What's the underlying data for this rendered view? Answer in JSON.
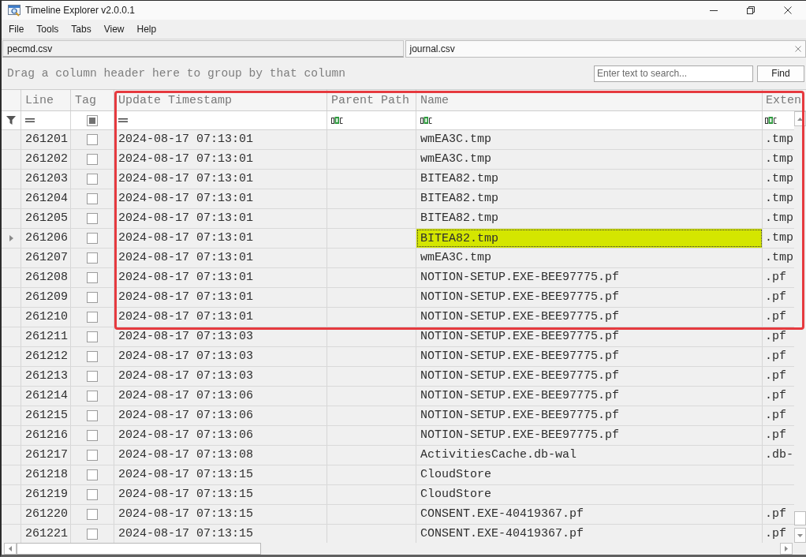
{
  "window": {
    "title": "Timeline Explorer v2.0.0.1"
  },
  "menu": [
    "File",
    "Tools",
    "Tabs",
    "View",
    "Help"
  ],
  "tabs": [
    {
      "label": "pecmd.csv",
      "selected": false
    },
    {
      "label": "journal.csv",
      "selected": true
    }
  ],
  "group_panel": {
    "hint": "Drag a column header here to group by that column"
  },
  "search": {
    "placeholder": "Enter text to search...",
    "button": "Find"
  },
  "table": {
    "columns": [
      {
        "label": "Line",
        "filter": {
          "kind": "equals"
        }
      },
      {
        "label": "Tag",
        "filter": {
          "kind": "tristate",
          "indeterminate": true
        }
      },
      {
        "label": "Update Timestamp",
        "filter": {
          "kind": "equals"
        }
      },
      {
        "label": "Parent Path",
        "filter": {
          "kind": "text"
        }
      },
      {
        "label": "Name",
        "filter": {
          "kind": "text"
        }
      },
      {
        "label": "Exten",
        "filter": {
          "kind": "text"
        }
      }
    ],
    "rows": [
      {
        "line": "261201",
        "tagged": false,
        "update_timestamp": "2024-08-17 07:13:01",
        "name": "wmEA3C.tmp",
        "extension": ".tmp",
        "selected": false,
        "name_focused": false
      },
      {
        "line": "261202",
        "tagged": false,
        "update_timestamp": "2024-08-17 07:13:01",
        "name": "wmEA3C.tmp",
        "extension": ".tmp",
        "selected": false,
        "name_focused": false
      },
      {
        "line": "261203",
        "tagged": false,
        "update_timestamp": "2024-08-17 07:13:01",
        "name": "BITEA82.tmp",
        "extension": ".tmp",
        "selected": false,
        "name_focused": false
      },
      {
        "line": "261204",
        "tagged": false,
        "update_timestamp": "2024-08-17 07:13:01",
        "name": "BITEA82.tmp",
        "extension": ".tmp",
        "selected": false,
        "name_focused": false
      },
      {
        "line": "261205",
        "tagged": false,
        "update_timestamp": "2024-08-17 07:13:01",
        "name": "BITEA82.tmp",
        "extension": ".tmp",
        "selected": false,
        "name_focused": false
      },
      {
        "line": "261206",
        "tagged": false,
        "update_timestamp": "2024-08-17 07:13:01",
        "name": "BITEA82.tmp",
        "extension": ".tmp",
        "selected": true,
        "name_focused": true
      },
      {
        "line": "261207",
        "tagged": false,
        "update_timestamp": "2024-08-17 07:13:01",
        "name": "wmEA3C.tmp",
        "extension": ".tmp",
        "selected": false,
        "name_focused": false
      },
      {
        "line": "261208",
        "tagged": false,
        "update_timestamp": "2024-08-17 07:13:01",
        "name": "NOTION-SETUP.EXE-BEE97775.pf",
        "extension": ".pf",
        "selected": false,
        "name_focused": false
      },
      {
        "line": "261209",
        "tagged": false,
        "update_timestamp": "2024-08-17 07:13:01",
        "name": "NOTION-SETUP.EXE-BEE97775.pf",
        "extension": ".pf",
        "selected": false,
        "name_focused": false
      },
      {
        "line": "261210",
        "tagged": false,
        "update_timestamp": "2024-08-17 07:13:01",
        "name": "NOTION-SETUP.EXE-BEE97775.pf",
        "extension": ".pf",
        "selected": false,
        "name_focused": false
      },
      {
        "line": "261211",
        "tagged": false,
        "update_timestamp": "2024-08-17 07:13:03",
        "name": "NOTION-SETUP.EXE-BEE97775.pf",
        "extension": ".pf",
        "selected": false,
        "name_focused": false
      },
      {
        "line": "261212",
        "tagged": false,
        "update_timestamp": "2024-08-17 07:13:03",
        "name": "NOTION-SETUP.EXE-BEE97775.pf",
        "extension": ".pf",
        "selected": false,
        "name_focused": false
      },
      {
        "line": "261213",
        "tagged": false,
        "update_timestamp": "2024-08-17 07:13:03",
        "name": "NOTION-SETUP.EXE-BEE97775.pf",
        "extension": ".pf",
        "selected": false,
        "name_focused": false
      },
      {
        "line": "261214",
        "tagged": false,
        "update_timestamp": "2024-08-17 07:13:06",
        "name": "NOTION-SETUP.EXE-BEE97775.pf",
        "extension": ".pf",
        "selected": false,
        "name_focused": false
      },
      {
        "line": "261215",
        "tagged": false,
        "update_timestamp": "2024-08-17 07:13:06",
        "name": "NOTION-SETUP.EXE-BEE97775.pf",
        "extension": ".pf",
        "selected": false,
        "name_focused": false
      },
      {
        "line": "261216",
        "tagged": false,
        "update_timestamp": "2024-08-17 07:13:06",
        "name": "NOTION-SETUP.EXE-BEE97775.pf",
        "extension": ".pf",
        "selected": false,
        "name_focused": false
      },
      {
        "line": "261217",
        "tagged": false,
        "update_timestamp": "2024-08-17 07:13:08",
        "name": "ActivitiesCache.db-wal",
        "extension": ".db-",
        "selected": false,
        "name_focused": false
      },
      {
        "line": "261218",
        "tagged": false,
        "update_timestamp": "2024-08-17 07:13:15",
        "name": "CloudStore",
        "selected": false,
        "name_focused": false
      },
      {
        "line": "261219",
        "tagged": false,
        "update_timestamp": "2024-08-17 07:13:15",
        "name": "CloudStore",
        "selected": false,
        "name_focused": false
      },
      {
        "line": "261220",
        "tagged": false,
        "update_timestamp": "2024-08-17 07:13:15",
        "name": "CONSENT.EXE-40419367.pf",
        "extension": ".pf",
        "selected": false,
        "name_focused": false
      },
      {
        "line": "261221",
        "tagged": false,
        "update_timestamp": "2024-08-17 07:13:15",
        "name": "CONSENT.EXE-40419367.pf",
        "extension": ".pf",
        "selected": false,
        "name_focused": false
      }
    ]
  },
  "annotation": {
    "kind": "rectangle"
  }
}
